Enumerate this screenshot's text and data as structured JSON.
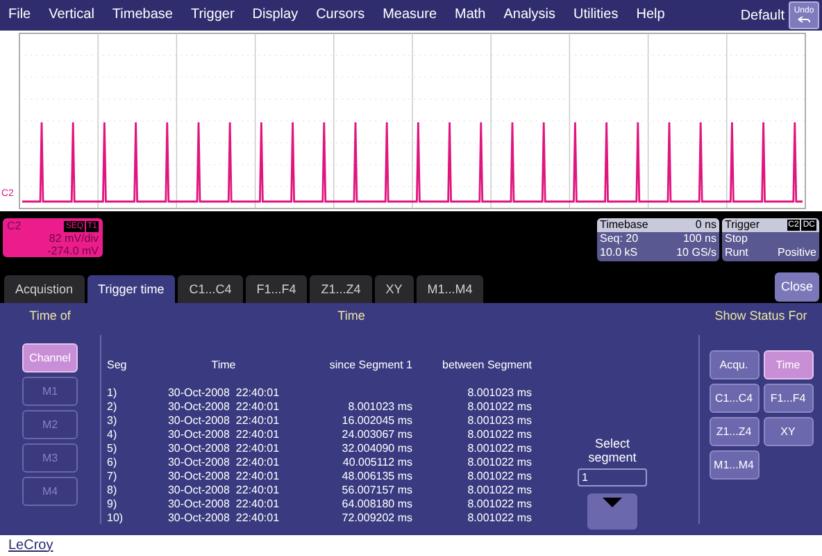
{
  "menu": {
    "items": [
      "File",
      "Vertical",
      "Timebase",
      "Trigger",
      "Display",
      "Cursors",
      "Measure",
      "Math",
      "Analysis",
      "Utilities",
      "Help"
    ],
    "default_label": "Default",
    "undo": "Undo"
  },
  "waveform": {
    "trace_label": "C2"
  },
  "channel": {
    "name": "C2",
    "badges": [
      "SEQ",
      "T1"
    ],
    "scale": "82 mV/div",
    "offset": "-274.0 mV"
  },
  "timebase": {
    "title": "Timebase",
    "delay": "0 ns",
    "mode": "Seq: 20",
    "per_div": "100 ns",
    "samples": "10.0 kS",
    "rate": "10 GS/s"
  },
  "trigger": {
    "title": "Trigger",
    "badges": [
      "C2",
      "DC"
    ],
    "state": "Stop",
    "type": "Runt",
    "slope": "Positive"
  },
  "tabs": [
    {
      "label": "Acquistion",
      "selected": false
    },
    {
      "label": "Trigger time",
      "selected": true
    },
    {
      "label": "C1...C4",
      "selected": false
    },
    {
      "label": "F1...F4",
      "selected": false
    },
    {
      "label": "Z1...Z4",
      "selected": false
    },
    {
      "label": "XY",
      "selected": false
    },
    {
      "label": "M1...M4",
      "selected": false
    }
  ],
  "close": "Close",
  "time_of": {
    "title": "Time of",
    "buttons": [
      {
        "label": "Channel",
        "selected": true,
        "disabled": false
      },
      {
        "label": "M1",
        "selected": false,
        "disabled": true
      },
      {
        "label": "M2",
        "selected": false,
        "disabled": true
      },
      {
        "label": "M3",
        "selected": false,
        "disabled": true
      },
      {
        "label": "M4",
        "selected": false,
        "disabled": true
      }
    ]
  },
  "table": {
    "title": "Time",
    "columns": [
      "Seg",
      "Time",
      "since Segment 1",
      "between Segment"
    ],
    "rows": [
      [
        "1)",
        "30-Oct-2008  22:40:01",
        "",
        "8.001023 ms"
      ],
      [
        "2)",
        "30-Oct-2008  22:40:01",
        "8.001023 ms",
        "8.001022 ms"
      ],
      [
        "3)",
        "30-Oct-2008  22:40:01",
        "16.002045 ms",
        "8.001023 ms"
      ],
      [
        "4)",
        "30-Oct-2008  22:40:01",
        "24.003067 ms",
        "8.001022 ms"
      ],
      [
        "5)",
        "30-Oct-2008  22:40:01",
        "32.004090 ms",
        "8.001022 ms"
      ],
      [
        "6)",
        "30-Oct-2008  22:40:01",
        "40.005112 ms",
        "8.001022 ms"
      ],
      [
        "7)",
        "30-Oct-2008  22:40:01",
        "48.006135 ms",
        "8.001022 ms"
      ],
      [
        "8)",
        "30-Oct-2008  22:40:01",
        "56.007157 ms",
        "8.001022 ms"
      ],
      [
        "9)",
        "30-Oct-2008  22:40:01",
        "64.008180 ms",
        "8.001022 ms"
      ],
      [
        "10)",
        "30-Oct-2008  22:40:01",
        "72.009202 ms",
        "8.001022 ms"
      ]
    ]
  },
  "select_segment": {
    "label": "Select segment",
    "value": "1"
  },
  "show_status": {
    "title": "Show Status For",
    "buttons": [
      {
        "label": "Acqu.",
        "selected": false
      },
      {
        "label": "Time",
        "selected": true
      },
      {
        "label": "C1...C4",
        "selected": false
      },
      {
        "label": "F1...F4",
        "selected": false
      },
      {
        "label": "Z1...Z4",
        "selected": false
      },
      {
        "label": "XY",
        "selected": false
      },
      {
        "label": "M1...M4",
        "selected": false
      }
    ]
  },
  "brand": "LeCroy"
}
